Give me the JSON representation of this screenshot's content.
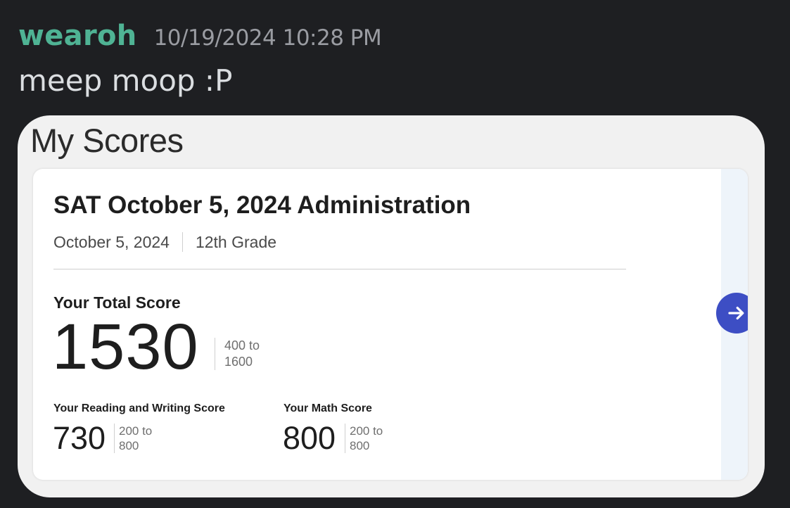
{
  "message": {
    "username": "wearoh",
    "timestamp": "10/19/2024 10:28 PM",
    "text": "meep moop :P"
  },
  "scores": {
    "heading": "My Scores",
    "administration": "SAT October 5, 2024 Administration",
    "date": "October 5, 2024",
    "grade": "12th Grade",
    "total_label": "Your Total Score",
    "total_score": "1530",
    "total_range": [
      "400 to",
      "1600"
    ],
    "reading_writing_label": "Your Reading and Writing Score",
    "reading_writing_score": "730",
    "reading_writing_range": [
      "200 to",
      "800"
    ],
    "math_label": "Your Math Score",
    "math_score": "800",
    "math_range": [
      "200 to",
      "800"
    ],
    "next_icon": "arrow-right-icon"
  },
  "colors": {
    "background": "#1e1f22",
    "username": "#4fb394",
    "accent_button": "#3d4ec4"
  }
}
